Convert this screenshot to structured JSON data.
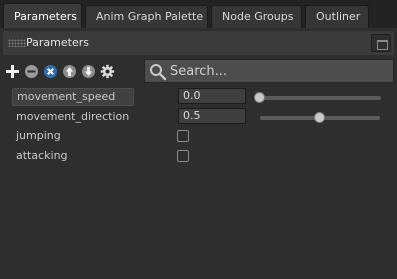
{
  "tabs": [
    {
      "label": "Parameters",
      "active": true
    },
    {
      "label": "Anim Graph Palette",
      "active": false
    },
    {
      "label": "Node Groups",
      "active": false
    },
    {
      "label": "Outliner",
      "active": false
    }
  ],
  "panel": {
    "title": "Parameters"
  },
  "toolbar": {
    "icons": [
      "add-icon",
      "remove-icon",
      "clear-icon",
      "move-up-icon",
      "move-down-icon",
      "settings-icon"
    ]
  },
  "search": {
    "placeholder": "Search...",
    "value": ""
  },
  "parameters": [
    {
      "name": "movement_speed",
      "type": "float",
      "value": "0.0",
      "slider_fraction": 0.0,
      "selected": true
    },
    {
      "name": "movement_direction",
      "type": "float",
      "value": "0.5",
      "slider_fraction": 0.5,
      "selected": false
    },
    {
      "name": "jumping",
      "type": "bool",
      "checked": false
    },
    {
      "name": "attacking",
      "type": "bool",
      "checked": false
    }
  ],
  "colors": {
    "accent_blue": "#2f6fb6",
    "background": "#2e2e2e"
  }
}
